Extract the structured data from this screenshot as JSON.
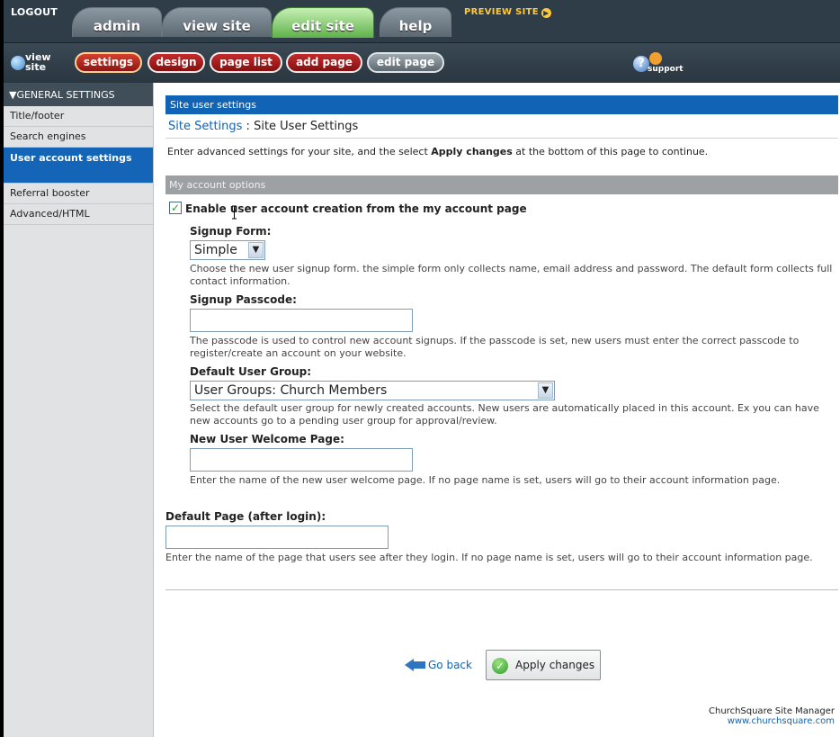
{
  "topbar": {
    "logout": "LOGOUT",
    "tabs": [
      {
        "label": "admin"
      },
      {
        "label": "view site"
      },
      {
        "label": "edit site"
      },
      {
        "label": "help"
      }
    ],
    "preview": "PREVIEW SITE"
  },
  "subbar": {
    "view_site_line1": "view",
    "view_site_line2": "site",
    "buttons": [
      {
        "label": "settings"
      },
      {
        "label": "design"
      },
      {
        "label": "page list"
      },
      {
        "label": "add page"
      },
      {
        "label": "edit page"
      }
    ],
    "support_label": "support",
    "help_glyph": "?"
  },
  "sidebar": {
    "header": "▼GENERAL SETTINGS",
    "items": [
      {
        "label": "Title/footer"
      },
      {
        "label": "Search engines"
      },
      {
        "label": "User account settings"
      },
      {
        "label": "Referral booster"
      },
      {
        "label": "Advanced/HTML"
      }
    ]
  },
  "main": {
    "section_title": "Site user settings",
    "breadcrumb_link": "Site Settings",
    "breadcrumb_sep": " : ",
    "breadcrumb_current": "Site User Settings",
    "intro_pre": "Enter advanced settings for your site, and the select ",
    "intro_bold": "Apply changes",
    "intro_post": " at the bottom of this page to continue.",
    "options_title": "My account options",
    "enable_label": "Enable user account creation from the my account page",
    "signup_form": {
      "label": "Signup Form:",
      "value": "Simple",
      "desc": "Choose the new user signup form. the simple form only collects name, email address and password. The default form collects full contact information."
    },
    "signup_passcode": {
      "label": "Signup Passcode:",
      "value": "",
      "desc": "The passcode is used to control new account signups. If the passcode is set, new users must enter the correct passcode to register/create an account on your website."
    },
    "default_group": {
      "label": "Default User Group:",
      "value": "User Groups: Church Members",
      "desc": "Select the default user group for newly created accounts. New users are automatically placed in this account. Ex you can have new accounts go to a pending user group for approval/review."
    },
    "welcome_page": {
      "label": "New User Welcome Page:",
      "value": "",
      "desc": "Enter the name of the new user welcome page. If no page name is set, users will go to their account information page."
    },
    "default_page": {
      "label": "Default Page (after login):",
      "value": "",
      "desc": "Enter the name of the page that users see after they login. If no page name is set, users will go to their account information page."
    },
    "go_back": "Go back",
    "apply": "Apply changes"
  },
  "footer": {
    "line1": "ChurchSquare Site Manager",
    "line2": "www.churchsquare.com"
  },
  "colors": {
    "accent_blue": "#1063b5",
    "topbar_dark": "#2f3d48",
    "active_tab_green": "#5fb14a",
    "pill_red": "#c42b2b"
  }
}
